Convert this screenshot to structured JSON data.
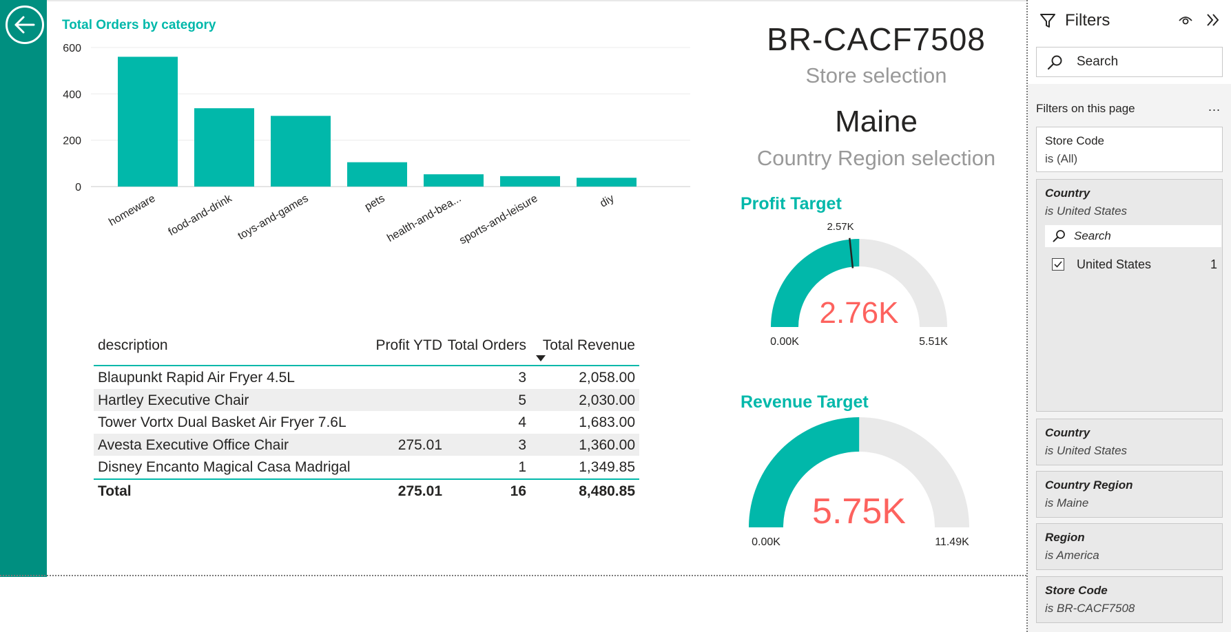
{
  "nav": {
    "back_icon": "arrow-left-circle-icon"
  },
  "chart_data": {
    "type": "bar",
    "title": "Total Orders by category",
    "categories": [
      "homeware",
      "food-and-drink",
      "toys-and-games",
      "pets",
      "health-and-bea...",
      "sports-and-leisure",
      "diy"
    ],
    "values": [
      560,
      338,
      305,
      105,
      53,
      45,
      38
    ],
    "ylim": [
      0,
      600
    ],
    "yticks": [
      0,
      200,
      400,
      600
    ],
    "grid": true,
    "color": "#01b8aa"
  },
  "table": {
    "headers": {
      "description": "description",
      "profit": "Profit YTD",
      "orders": "Total Orders",
      "revenue": "Total Revenue"
    },
    "rows": [
      {
        "description": "Blaupunkt Rapid Air Fryer 4.5L",
        "profit": "",
        "orders": "3",
        "revenue": "2,058.00"
      },
      {
        "description": "Hartley Executive Chair",
        "profit": "",
        "orders": "5",
        "revenue": "2,030.00"
      },
      {
        "description": "Tower Vortx Dual Basket Air Fryer 7.6L",
        "profit": "",
        "orders": "4",
        "revenue": "1,683.00"
      },
      {
        "description": "Avesta Executive Office Chair",
        "profit": "275.01",
        "orders": "3",
        "revenue": "1,360.00"
      },
      {
        "description": "Disney Encanto Magical Casa Madrigal",
        "profit": "",
        "orders": "1",
        "revenue": "1,349.85"
      }
    ],
    "total": {
      "label": "Total",
      "profit": "275.01",
      "orders": "16",
      "revenue": "8,480.85"
    }
  },
  "cards": {
    "store_code": "BR-CACF7508",
    "store_caption": "Store selection",
    "region": "Maine",
    "region_caption": "Country Region selection"
  },
  "gauges": {
    "profit": {
      "title": "Profit Target",
      "value_label": "2.76K",
      "min_label": "0.00K",
      "max_label": "5.51K",
      "target_label": "2.57K",
      "value": 2.76,
      "min": 0,
      "max": 5.51,
      "target": 2.57
    },
    "revenue": {
      "title": "Revenue Target",
      "value_label": "5.75K",
      "min_label": "0.00K",
      "max_label": "11.49K",
      "value": 5.75,
      "min": 0,
      "max": 11.49
    }
  },
  "filters": {
    "title": "Filters",
    "search_placeholder": "Search",
    "section_label": "Filters on this page",
    "more": "...",
    "cards": [
      {
        "name": "Store Code",
        "value": "is (All)"
      },
      {
        "name": "Country",
        "value": "is United States",
        "search_placeholder": "Search",
        "option": "United States",
        "option_count": "1"
      },
      {
        "name": "Country",
        "value": "is United States"
      },
      {
        "name": "Country Region",
        "value": "is Maine"
      },
      {
        "name": "Region",
        "value": "is America"
      },
      {
        "name": "Store Code",
        "value": "is BR-CACF7508"
      }
    ]
  },
  "colors": {
    "accent": "#01b8aa",
    "strip": "#008f80",
    "gauge_value": "#fd625e",
    "gauge_track": "#e9e9e9"
  }
}
